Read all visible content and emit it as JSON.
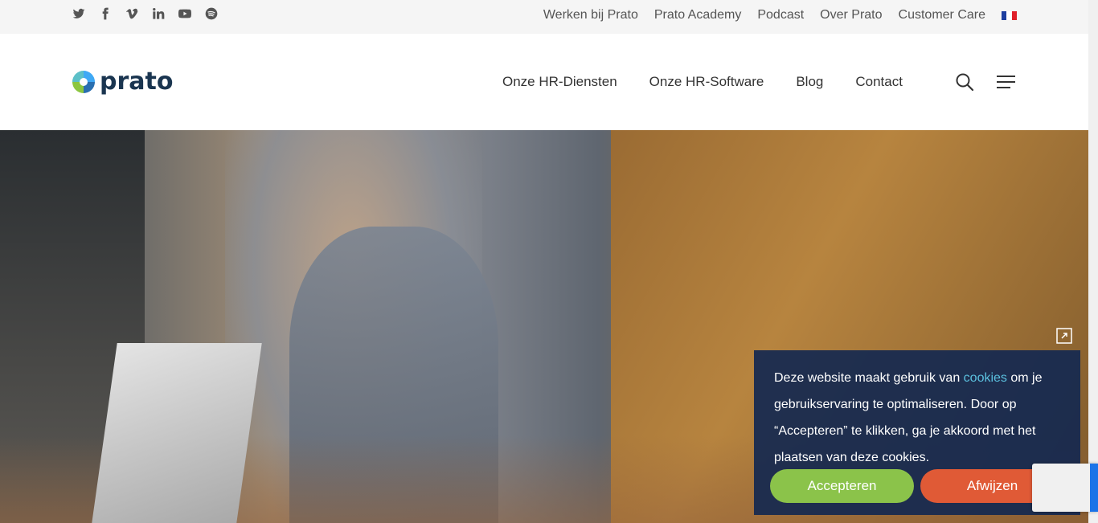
{
  "topbar": {
    "social_icons": [
      "twitter-icon",
      "facebook-icon",
      "vimeo-icon",
      "linkedin-icon",
      "youtube-icon",
      "spotify-icon"
    ],
    "links": [
      "Werken bij Prato",
      "Prato Academy",
      "Podcast",
      "Over Prato",
      "Customer Care"
    ],
    "language_flag": "french-flag-icon"
  },
  "header": {
    "logo_text": "prato",
    "nav": [
      "Onze HR-Diensten",
      "Onze HR-Software",
      "Blog",
      "Contact"
    ],
    "search_icon": "search-icon",
    "menu_icon": "hamburger-menu-icon"
  },
  "cookie": {
    "text_before": "Deze website maakt gebruik van ",
    "link_text": "cookies",
    "text_after": " om je gebruikservaring te optimaliseren. Door op “Accepteren” te klikken, ga je akkoord met het plaatsen van deze cookies.",
    "accept_label": "Accepteren",
    "reject_label": "Afwijzen"
  },
  "colors": {
    "accept": "#8bc34a",
    "reject": "#e05a36",
    "cookie_bg": "#142850",
    "link": "#5bc0de",
    "logo": "#1a3550"
  }
}
